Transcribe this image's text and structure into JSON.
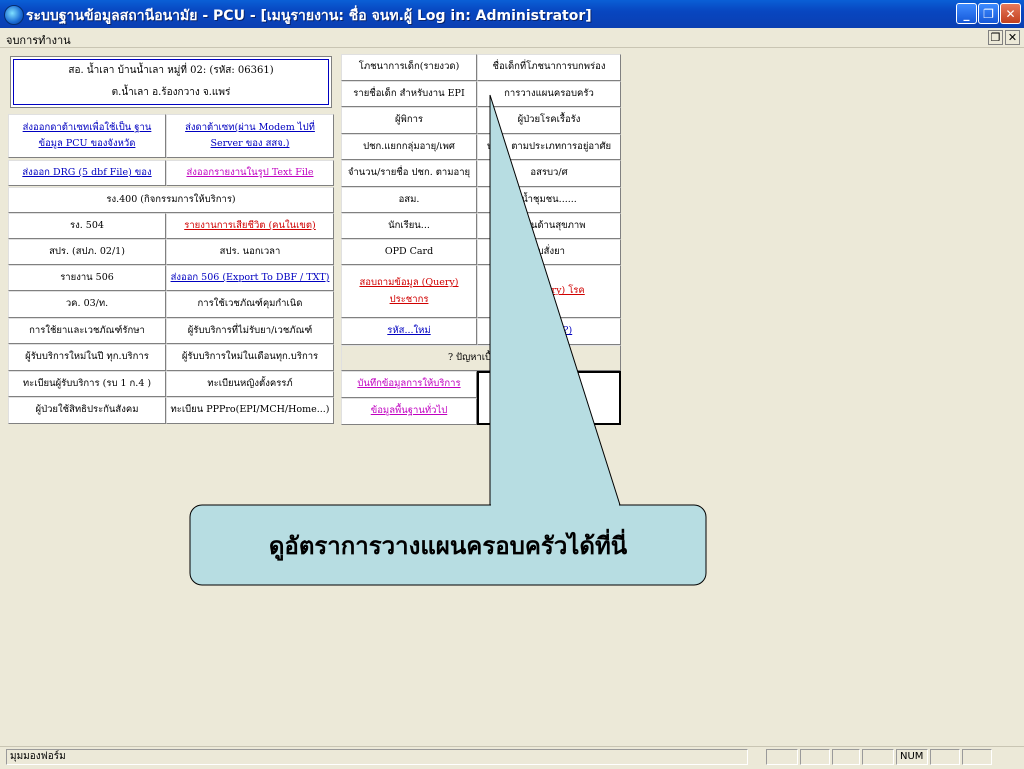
{
  "window": {
    "title": "ระบบฐานข้อมูลสถานีอนามัย - PCU - [เมนูรายงาน: ชื่อ จนท.ผู้ Log in: Administrator]",
    "minimize": "_",
    "restore": "❐",
    "close": "✕"
  },
  "menubar": {
    "label": "จบการทำงาน",
    "restore": "❐",
    "close": "✕"
  },
  "info": {
    "line1": "สอ. น้ำเลา บ้านน้ำเลา หมู่ที่ 02: (รหัส: 06361)",
    "line2": "ต.น้ำเลา อ.ร้องกวาง จ.แพร่"
  },
  "left": {
    "r1a": "ส่งออกดาต้าเซทเพื่อใช้เป็น ฐานข้อมูล PCU ของจังหวัด",
    "r1b": "ส่งดาต้าเซท(ผ่าน Modem ไปที่ Server ของ สสจ.)",
    "r2a": "ส่งออก DRG (5 dbf File) ของ",
    "r2b": "ส่งออกรายงานในรูป Text File",
    "r3": "รง.400 (กิจกรรมการให้บริการ)",
    "r4a": "รง. 504",
    "r4b": "รายงานการเสียชีวิต (คนในเขต)",
    "r5a": "สปร. (สปภ. 02/1)",
    "r5b": "สปร. นอกเวลา",
    "r6a": "รายงาน 506",
    "r6b": "ส่งออก 506 (Export To DBF / TXT)",
    "r7a": "วค. 03/ท.",
    "r7b": "การใช้เวชภัณฑ์คุมกำเนิด",
    "r8a": "การใช้ยาและเวชภัณฑ์รักษา",
    "r8b": "ผู้รับบริการที่ไม่รับยา/เวชภัณฑ์",
    "r9a": "ผู้รับบริการใหม่ในปี ทุก.บริการ",
    "r9b": "ผู้รับบริการใหม่ในเดือนทุก.บริการ",
    "r10a": "ทะเบียนผู้รับบริการ (รบ 1 ก.4 )",
    "r10b": "ทะเบียนหญิงตั้งครรภ์",
    "r11a": "ผู้ป่วยใช้สิทธิประกันสังคม",
    "r11b": "ทะเบียน PPPro(EPI/MCH/Home...)"
  },
  "right": {
    "c1a": "โภชนาการเด็ก(รายงวด)",
    "c1b": "ชื่อเด็กที่โภชนาการบกพร่อง",
    "c2a": "รายชื่อเด็ก สำหรับงาน EPI",
    "c2b": "การวางแผนครอบครัว",
    "c3a": "ผู้พิการ",
    "c3b": "ผู้ป่วยโรคเรื้อรัง",
    "c4a": "ปชก.แยกกลุ่มอายุ/เพศ",
    "c4b": "ปชก. ตามประเภทการอยู่อาศัย",
    "c5a": "จำนวน/รายชื่อ ปชก. ตามอายุ",
    "c5b": "อสรบว/ศ",
    "c6a": "อสม.",
    "c6b": "น้ำชุมชน......",
    "c7a": "นักเรียน...",
    "c7b": "คุ้มกันด้านสุขภาพ",
    "c8a": "OPD Card",
    "c8b": "ใบสั่งยา",
    "c9a": "สอบถามข้อมูล (Query) ประชากร",
    "c9b": "มูล (Query) โรค",
    "c10a": "รหัส...ใหม่",
    "c10b": "at New ?)",
    "c11": "? ปัญหาเบื้องต้น",
    "c12a": "บันทึกข้อมูลการให้บริการ",
    "c12b": "ข้อมูลพื้นฐานทั่วไป"
  },
  "callout": {
    "text": "ดูอัตราการวางแผนครอบครัวได้ที่นี่"
  },
  "status": {
    "left": "มุมมองฟอร์ม",
    "num": "NUM"
  }
}
